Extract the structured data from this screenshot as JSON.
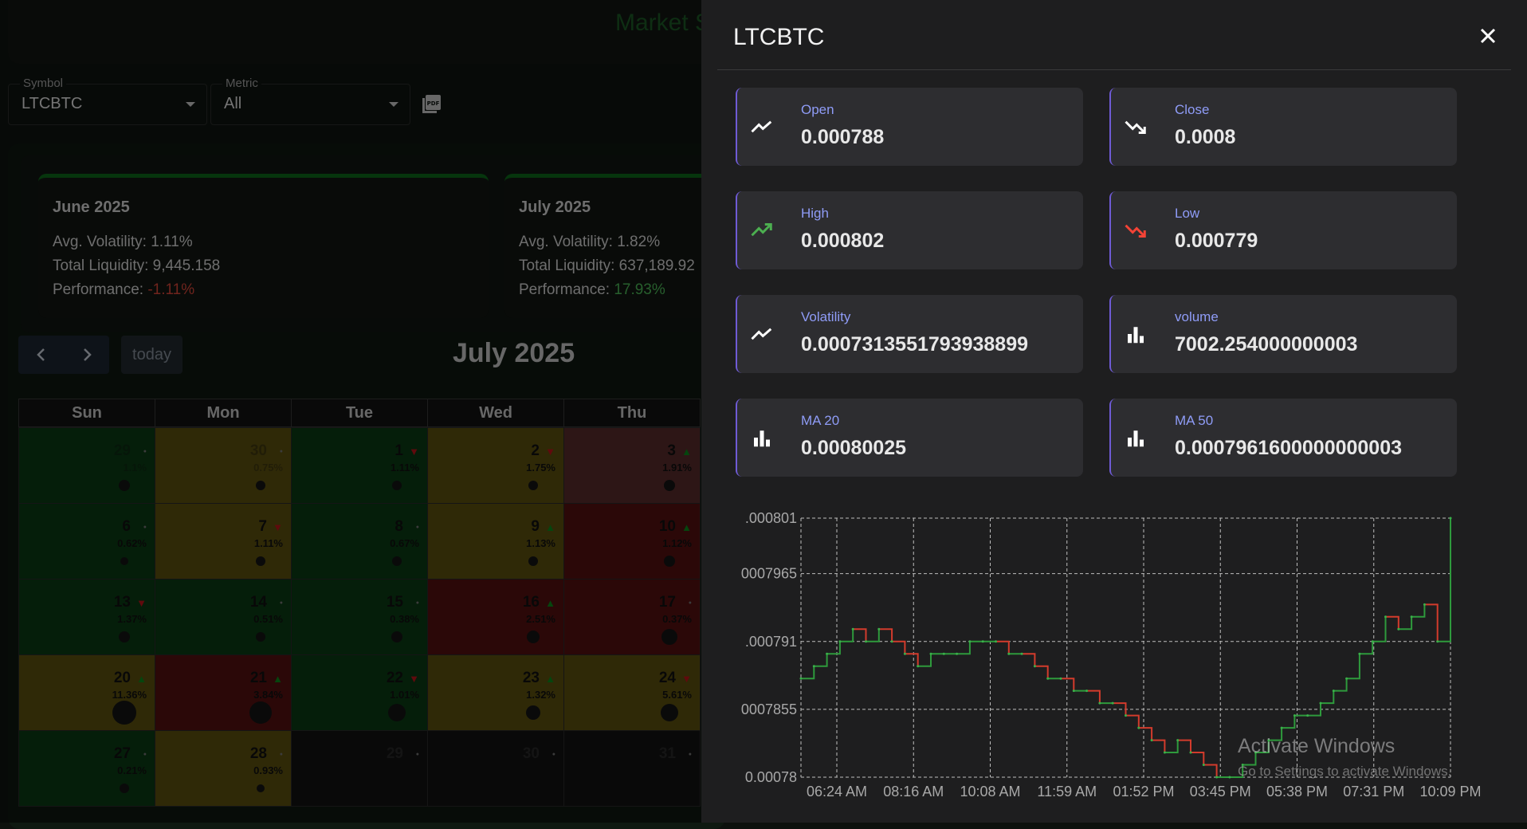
{
  "app": {
    "title": "Market S",
    "symbol_label": "Symbol",
    "symbol_value": "LTCBTC",
    "metric_label": "Metric",
    "metric_value": "All",
    "pdf_icon": "pdf-file-icon"
  },
  "summary_cards": [
    {
      "month": "June 2025",
      "volatility": "Avg. Volatility: 1.11%",
      "liquidity": "Total Liquidity: 9,445.158",
      "performance_label": "Performance:",
      "performance_value": "-1.11%"
    },
    {
      "month": "July 2025",
      "volatility": "Avg. Volatility: 1.82%",
      "liquidity": "Total Liquidity: 637,189.92",
      "performance_label": "Performance:",
      "performance_value": "17.93%"
    }
  ],
  "calendar": {
    "title": "July 2025",
    "today_label": "today",
    "headers": [
      "Sun",
      "Mon",
      "Tue",
      "Wed",
      "Thu"
    ],
    "weeks": [
      [
        {
          "d": "29",
          "p": "1.1%",
          "c": "green",
          "a": "",
          "dim": true,
          "dot": 14
        },
        {
          "d": "30",
          "p": "0.75%",
          "c": "yellow",
          "a": "",
          "dim": true,
          "dot": 12
        },
        {
          "d": "1",
          "p": "1.11%",
          "c": "green",
          "a": "down",
          "dim": false,
          "dot": 12
        },
        {
          "d": "2",
          "p": "1.75%",
          "c": "yellow",
          "a": "down",
          "dim": false,
          "dot": 12
        },
        {
          "d": "3",
          "p": "1.91%",
          "c": "pink",
          "a": "up",
          "dim": false,
          "dot": 14
        }
      ],
      [
        {
          "d": "6",
          "p": "0.62%",
          "c": "green",
          "a": "dot",
          "dim": false,
          "dot": 10
        },
        {
          "d": "7",
          "p": "1.11%",
          "c": "yellow",
          "a": "down",
          "dim": false,
          "dot": 12
        },
        {
          "d": "8",
          "p": "0.67%",
          "c": "green",
          "a": "dot",
          "dim": false,
          "dot": 12
        },
        {
          "d": "9",
          "p": "1.13%",
          "c": "yellow",
          "a": "up",
          "dim": false,
          "dot": 12
        },
        {
          "d": "10",
          "p": "1.12%",
          "c": "red",
          "a": "up",
          "dim": false,
          "dot": 14
        }
      ],
      [
        {
          "d": "13",
          "p": "1.37%",
          "c": "green",
          "a": "down",
          "dim": false,
          "dot": 14
        },
        {
          "d": "14",
          "p": "0.51%",
          "c": "green",
          "a": "dot",
          "dim": false,
          "dot": 12
        },
        {
          "d": "15",
          "p": "0.38%",
          "c": "green",
          "a": "dot",
          "dim": false,
          "dot": 14
        },
        {
          "d": "16",
          "p": "2.51%",
          "c": "red",
          "a": "up",
          "dim": false,
          "dot": 16
        },
        {
          "d": "17",
          "p": "0.37%",
          "c": "red",
          "a": "dot",
          "dim": false,
          "dot": 20
        }
      ],
      [
        {
          "d": "20",
          "p": "11.36%",
          "c": "yellow",
          "a": "up",
          "dim": false,
          "dot": 30
        },
        {
          "d": "21",
          "p": "3.84%",
          "c": "red",
          "a": "up",
          "dim": false,
          "dot": 28
        },
        {
          "d": "22",
          "p": "1.01%",
          "c": "green",
          "a": "down",
          "dim": false,
          "dot": 22
        },
        {
          "d": "23",
          "p": "1.32%",
          "c": "yellow",
          "a": "up",
          "dim": false,
          "dot": 18
        },
        {
          "d": "24",
          "p": "5.61%",
          "c": "yellow",
          "a": "down",
          "dim": false,
          "dot": 22
        }
      ],
      [
        {
          "d": "27",
          "p": "0.21%",
          "c": "green",
          "a": "dot",
          "dim": false,
          "dot": 12
        },
        {
          "d": "28",
          "p": "0.93%",
          "c": "yellow",
          "a": "dot",
          "dim": false,
          "dot": 10
        },
        {
          "d": "29",
          "p": "",
          "c": "none",
          "a": "dot",
          "dim": true,
          "dot": 0
        },
        {
          "d": "30",
          "p": "",
          "c": "none",
          "a": "dot",
          "dim": true,
          "dot": 0
        },
        {
          "d": "31",
          "p": "",
          "c": "none",
          "a": "dot",
          "dim": true,
          "dot": 0
        }
      ]
    ]
  },
  "drawer": {
    "title": "LTCBTC",
    "close_icon": "close-icon",
    "stats": [
      {
        "label": "Open",
        "value": "0.000788",
        "icon": "trending-flat-icon",
        "icon_color": "#ffffff"
      },
      {
        "label": "Close",
        "value": "0.0008",
        "icon": "trending-down-icon",
        "icon_color": "#ffffff"
      },
      {
        "label": "High",
        "value": "0.000802",
        "icon": "trending-up-icon",
        "icon_color": "#4caf50"
      },
      {
        "label": "Low",
        "value": "0.000779",
        "icon": "trending-down-icon",
        "icon_color": "#f44336"
      },
      {
        "label": "Volatility",
        "value": "0.0007313551793938899",
        "icon": "trending-flat-icon",
        "icon_color": "#ffffff"
      },
      {
        "label": "volume",
        "value": "7002.254000000003",
        "icon": "bar-chart-icon",
        "icon_color": "#ffffff"
      },
      {
        "label": "MA 20",
        "value": "0.00080025",
        "icon": "bar-chart-icon",
        "icon_color": "#ffffff"
      },
      {
        "label": "MA 50",
        "value": "0.0007961600000000003",
        "icon": "bar-chart-icon",
        "icon_color": "#ffffff"
      }
    ]
  },
  "chart_data": {
    "type": "line",
    "title": "",
    "xlabel": "",
    "ylabel": "",
    "y_tick_labels": [
      ".000801",
      "0007965",
      ".000791",
      "0007855",
      "0.00078"
    ],
    "ylim": [
      0.00078,
      0.000801
    ],
    "x_tick_labels": [
      "06:24 AM",
      "08:16 AM",
      "10:08 AM",
      "11:59 AM",
      "01:52 PM",
      "03:45 PM",
      "05:38 PM",
      "07:31 PM",
      "10:09 PM"
    ],
    "grid": true,
    "series": [
      {
        "x": [
          0.0,
          0.02,
          0.04,
          0.06,
          0.08,
          0.1,
          0.12,
          0.14,
          0.16,
          0.18,
          0.2,
          0.22,
          0.24,
          0.26,
          0.28,
          0.3,
          0.32,
          0.34,
          0.36,
          0.38,
          0.4,
          0.42,
          0.44,
          0.46,
          0.48,
          0.5,
          0.52,
          0.54,
          0.56,
          0.58,
          0.6,
          0.62,
          0.64,
          0.66,
          0.68,
          0.7,
          0.72,
          0.74,
          0.76,
          0.78,
          0.8,
          0.82,
          0.84,
          0.86,
          0.88,
          0.9,
          0.92,
          0.94,
          0.96,
          0.98,
          1.0
        ],
        "values": [
          0.000788,
          0.000789,
          0.00079,
          0.000791,
          0.000792,
          0.000791,
          0.000792,
          0.000791,
          0.00079,
          0.000789,
          0.00079,
          0.00079,
          0.00079,
          0.000791,
          0.000791,
          0.000791,
          0.00079,
          0.00079,
          0.000789,
          0.000788,
          0.000788,
          0.000787,
          0.000787,
          0.000786,
          0.000786,
          0.000785,
          0.000784,
          0.000783,
          0.000782,
          0.000783,
          0.000782,
          0.000781,
          0.00078,
          0.00078,
          0.000781,
          0.000782,
          0.000783,
          0.000784,
          0.000785,
          0.000785,
          0.000786,
          0.000787,
          0.000788,
          0.00079,
          0.000791,
          0.000793,
          0.000792,
          0.000793,
          0.000794,
          0.000791,
          0.000801
        ]
      }
    ]
  },
  "watermark": {
    "line1": "Activate Windows",
    "line2": "Go to Settings to activate Windows."
  }
}
